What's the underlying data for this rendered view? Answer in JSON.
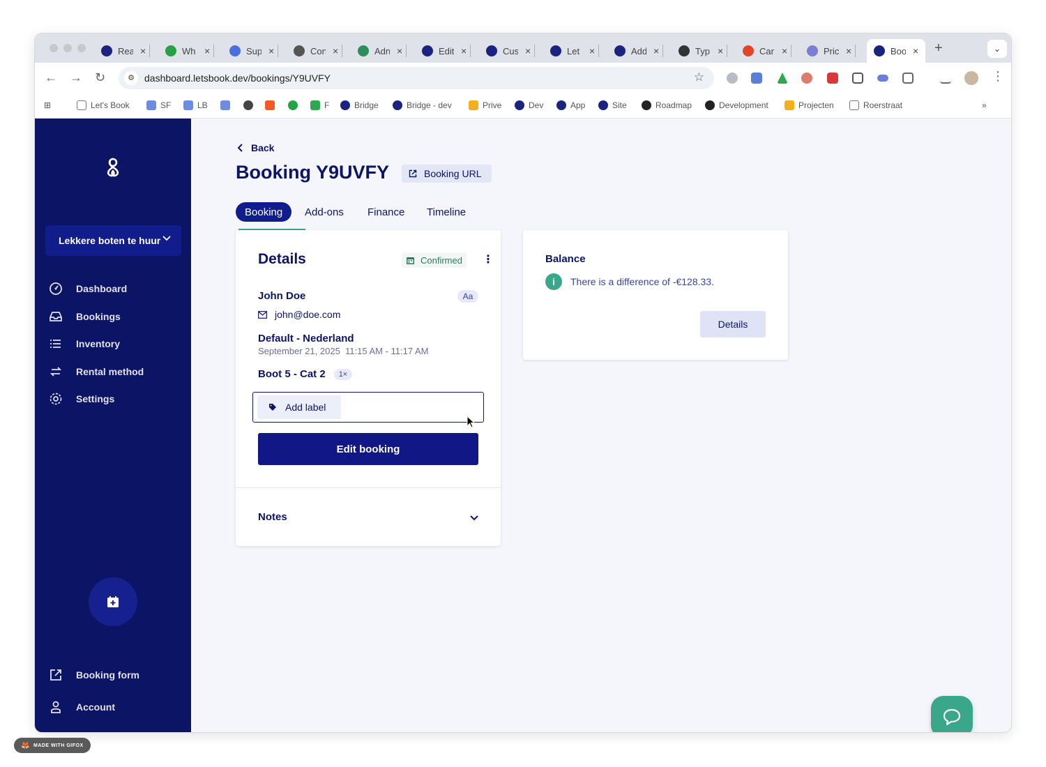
{
  "browser": {
    "tabs": [
      {
        "label": "Rea",
        "icon": "letsbook-icon",
        "color": "#1b2380"
      },
      {
        "label": "Wh",
        "icon": "whatsapp-icon",
        "color": "#25a244"
      },
      {
        "label": "Sup",
        "icon": "doc-icon",
        "color": "#4a6ee0"
      },
      {
        "label": "Con",
        "icon": "globe-icon",
        "color": "#555555"
      },
      {
        "label": "Adn",
        "icon": "book-icon",
        "color": "#2a8f5a"
      },
      {
        "label": "Edit",
        "icon": "letsbook-icon",
        "color": "#1b2380"
      },
      {
        "label": "Cus",
        "icon": "letsbook-icon",
        "color": "#1b2380"
      },
      {
        "label": "Let",
        "icon": "letsbook-icon",
        "color": "#1b2380"
      },
      {
        "label": "Add",
        "icon": "letsbook-icon",
        "color": "#1b2380"
      },
      {
        "label": "Typ",
        "icon": "typefully-icon",
        "color": "#333333"
      },
      {
        "label": "Car",
        "icon": "reddit-icon",
        "color": "#e0452a"
      },
      {
        "label": "Pric",
        "icon": "ethereum-icon",
        "color": "#7b7fd1"
      },
      {
        "label": "Boo",
        "icon": "letsbook-icon",
        "color": "#1b2380"
      }
    ],
    "url": "dashboard.letsbook.dev/bookings/Y9UVFY",
    "bookmarks": [
      {
        "label": "Let's Book",
        "icon": "folder-icon"
      },
      {
        "label": "SF",
        "icon": "calendar-icon"
      },
      {
        "label": "LB",
        "icon": "calendar-icon"
      },
      {
        "label": "",
        "icon": "calendar-icon"
      },
      {
        "label": "",
        "icon": "openai-icon"
      },
      {
        "label": "",
        "icon": "soundcloud-icon"
      },
      {
        "label": "",
        "icon": "whatsapp-icon"
      },
      {
        "label": "F",
        "icon": "sheets-icon"
      },
      {
        "label": "Bridge",
        "icon": "letsbook-icon"
      },
      {
        "label": "Bridge - dev",
        "icon": "letsbook-icon"
      },
      {
        "label": "Prive",
        "icon": "drive-icon"
      },
      {
        "label": "Dev",
        "icon": "letsbook-icon"
      },
      {
        "label": "App",
        "icon": "letsbook-icon"
      },
      {
        "label": "Site",
        "icon": "letsbook-icon"
      },
      {
        "label": "Roadmap",
        "icon": "github-icon"
      },
      {
        "label": "Development",
        "icon": "github-icon"
      },
      {
        "label": "Projecten",
        "icon": "drive-icon"
      },
      {
        "label": "Roerstraat",
        "icon": "folder-icon"
      }
    ]
  },
  "sidebar": {
    "company": "Lekkere boten te huur",
    "items": [
      {
        "label": "Dashboard",
        "icon": "dashboard-icon"
      },
      {
        "label": "Bookings",
        "icon": "inbox-icon"
      },
      {
        "label": "Inventory",
        "icon": "list-icon"
      },
      {
        "label": "Rental method",
        "icon": "swap-icon"
      },
      {
        "label": "Settings",
        "icon": "gear-icon"
      }
    ],
    "bottom": [
      {
        "label": "Booking form",
        "icon": "external-link-icon"
      },
      {
        "label": "Account",
        "icon": "user-icon"
      }
    ]
  },
  "page": {
    "back": "Back",
    "title": "Booking Y9UVFY",
    "booking_url": "Booking URL",
    "tabs": [
      "Booking",
      "Add-ons",
      "Finance",
      "Timeline"
    ]
  },
  "details": {
    "heading": "Details",
    "status": "Confirmed",
    "customer_name": "John Doe",
    "customer_badge": "Aa",
    "email": "john@doe.com",
    "location": "Default - Nederland",
    "datetime": "September 21, 2025  11:15 AM - 11:17 AM",
    "item": "Boot 5 - Cat 2",
    "quantity": "1×",
    "add_label": "Add label",
    "edit_button": "Edit booking",
    "notes": "Notes"
  },
  "balance": {
    "heading": "Balance",
    "message": "There is a difference of -€128.33.",
    "details_button": "Details"
  },
  "overlay": {
    "watermark": "MADE WITH GIFOX"
  },
  "colors": {
    "sidebar": "#0c1466",
    "accent": "#111784",
    "success": "#3aa68a"
  }
}
